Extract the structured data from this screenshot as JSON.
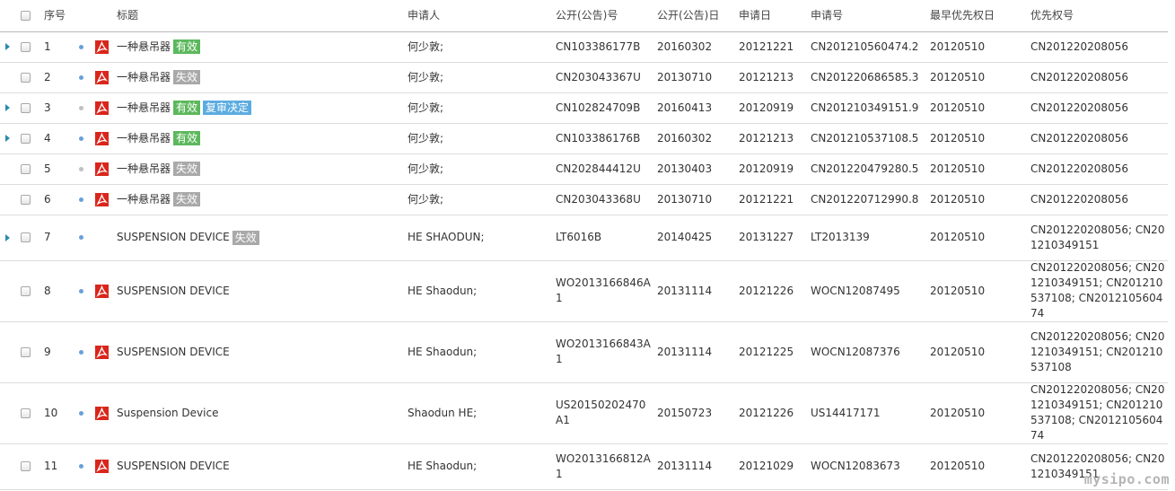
{
  "colors": {
    "valid": "#5cb85c",
    "invalid": "#a9a9a9",
    "review": "#5bace0",
    "dot_blue": "#6aa0d8",
    "dot_gray": "#c0c0c0",
    "pdf_red": "#d9261c"
  },
  "header": {
    "no": "序号",
    "title": "标题",
    "applicant": "申请人",
    "pub_no": "公开(公告)号",
    "pub_date": "公开(公告)日",
    "app_date": "申请日",
    "app_no": "申请号",
    "earliest_priority_date": "最早优先权日",
    "priority_no": "优先权号"
  },
  "rows": [
    {
      "no": "1",
      "title": "一种悬吊器",
      "badges": [
        {
          "text": "有效",
          "type": "valid"
        }
      ],
      "dot": "blue",
      "expand": true,
      "applicant": "何少敦;",
      "pub_no": "CN103386177B",
      "pub_date": "20160302",
      "app_date": "20121221",
      "app_no": "CN201210560474.2",
      "earliest_priority_date": "20120510",
      "priority_no": "CN201220208056"
    },
    {
      "no": "2",
      "title": "一种悬吊器",
      "badges": [
        {
          "text": "失效",
          "type": "invalid"
        }
      ],
      "dot": "blue",
      "expand": false,
      "applicant": "何少敦;",
      "pub_no": "CN203043367U",
      "pub_date": "20130710",
      "app_date": "20121213",
      "app_no": "CN201220686585.3",
      "earliest_priority_date": "20120510",
      "priority_no": "CN201220208056"
    },
    {
      "no": "3",
      "title": "一种悬吊器",
      "badges": [
        {
          "text": "有效",
          "type": "valid"
        },
        {
          "text": "复审决定",
          "type": "review"
        }
      ],
      "dot": "gray",
      "expand": true,
      "applicant": "何少敦;",
      "pub_no": "CN102824709B",
      "pub_date": "20160413",
      "app_date": "20120919",
      "app_no": "CN201210349151.9",
      "earliest_priority_date": "20120510",
      "priority_no": "CN201220208056"
    },
    {
      "no": "4",
      "title": "一种悬吊器",
      "badges": [
        {
          "text": "有效",
          "type": "valid"
        }
      ],
      "dot": "blue",
      "expand": true,
      "applicant": "何少敦;",
      "pub_no": "CN103386176B",
      "pub_date": "20160302",
      "app_date": "20121213",
      "app_no": "CN201210537108.5",
      "earliest_priority_date": "20120510",
      "priority_no": "CN201220208056"
    },
    {
      "no": "5",
      "title": "一种悬吊器",
      "badges": [
        {
          "text": "失效",
          "type": "invalid"
        }
      ],
      "dot": "gray",
      "expand": false,
      "applicant": "何少敦;",
      "pub_no": "CN202844412U",
      "pub_date": "20130403",
      "app_date": "20120919",
      "app_no": "CN201220479280.5",
      "earliest_priority_date": "20120510",
      "priority_no": "CN201220208056"
    },
    {
      "no": "6",
      "title": "一种悬吊器",
      "badges": [
        {
          "text": "失效",
          "type": "invalid"
        }
      ],
      "dot": "blue",
      "expand": false,
      "applicant": "何少敦;",
      "pub_no": "CN203043368U",
      "pub_date": "20130710",
      "app_date": "20121221",
      "app_no": "CN201220712990.8",
      "earliest_priority_date": "20120510",
      "priority_no": "CN201220208056"
    },
    {
      "no": "7",
      "title": "SUSPENSION DEVICE",
      "badges": [
        {
          "text": "失效",
          "type": "invalid"
        }
      ],
      "dot": "blue",
      "expand": true,
      "no_pdf": true,
      "applicant": "HE SHAODUN;",
      "pub_no": "LT6016B",
      "pub_date": "20140425",
      "app_date": "20131227",
      "app_no": "LT2013139",
      "earliest_priority_date": "20120510",
      "priority_no": "CN201220208056; CN201210349151"
    },
    {
      "no": "8",
      "title": "SUSPENSION DEVICE",
      "badges": [],
      "dot": "blue",
      "expand": false,
      "applicant": "HE Shaodun;",
      "pub_no": "WO2013166846A1",
      "pub_date": "20131114",
      "app_date": "20121226",
      "app_no": "WOCN12087495",
      "earliest_priority_date": "20120510",
      "priority_no": "CN201220208056; CN201210349151; CN201210537108; CN201210560474"
    },
    {
      "no": "9",
      "title": "SUSPENSION DEVICE",
      "badges": [],
      "dot": "blue",
      "expand": false,
      "applicant": "HE Shaodun;",
      "pub_no": "WO2013166843A1",
      "pub_date": "20131114",
      "app_date": "20121225",
      "app_no": "WOCN12087376",
      "earliest_priority_date": "20120510",
      "priority_no": "CN201220208056; CN201210349151; CN201210537108"
    },
    {
      "no": "10",
      "title": "Suspension Device",
      "badges": [],
      "dot": "blue",
      "expand": false,
      "applicant": "Shaodun HE;",
      "pub_no": "US20150202470A1",
      "pub_date": "20150723",
      "app_date": "20121226",
      "app_no": "US14417171",
      "earliest_priority_date": "20120510",
      "priority_no": "CN201220208056; CN201210349151; CN201210537108; CN201210560474"
    },
    {
      "no": "11",
      "title": "SUSPENSION DEVICE",
      "badges": [],
      "dot": "blue",
      "expand": false,
      "applicant": "HE Shaodun;",
      "pub_no": "WO2013166812A1",
      "pub_date": "20131114",
      "app_date": "20121029",
      "app_no": "WOCN12083673",
      "earliest_priority_date": "20120510",
      "priority_no": "CN201220208056; CN201210349151"
    }
  ],
  "watermark": "mysipo.com"
}
